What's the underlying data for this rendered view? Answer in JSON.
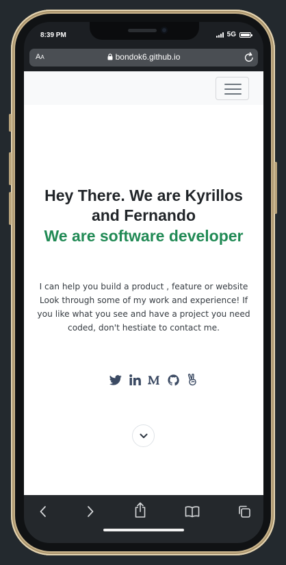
{
  "status": {
    "time": "8:39 PM",
    "network": "5G"
  },
  "browser": {
    "aa_large": "A",
    "aa_small": "A",
    "url": "bondok6.github.io"
  },
  "hero": {
    "heading": "Hey There. We are Kyrillos and Fernando",
    "subheading": "We are software developer",
    "description": "I can help you build a product , feature or website Look through some of my work and experience! If you like what you see and have a project you need coded, don't hestiate to contact me."
  },
  "socials": [
    {
      "icon": "twitter-icon"
    },
    {
      "icon": "linkedin-icon"
    },
    {
      "icon": "medium-icon"
    },
    {
      "icon": "github-icon"
    },
    {
      "icon": "peace-hand-icon"
    }
  ],
  "toolbar": [
    "back-icon",
    "forward-icon",
    "share-icon",
    "bookmarks-icon",
    "tabs-icon"
  ],
  "colors": {
    "accent": "#218a55",
    "text": "#212529",
    "icon": "#3b4a63",
    "navbar_bg": "#f8f9fa"
  }
}
